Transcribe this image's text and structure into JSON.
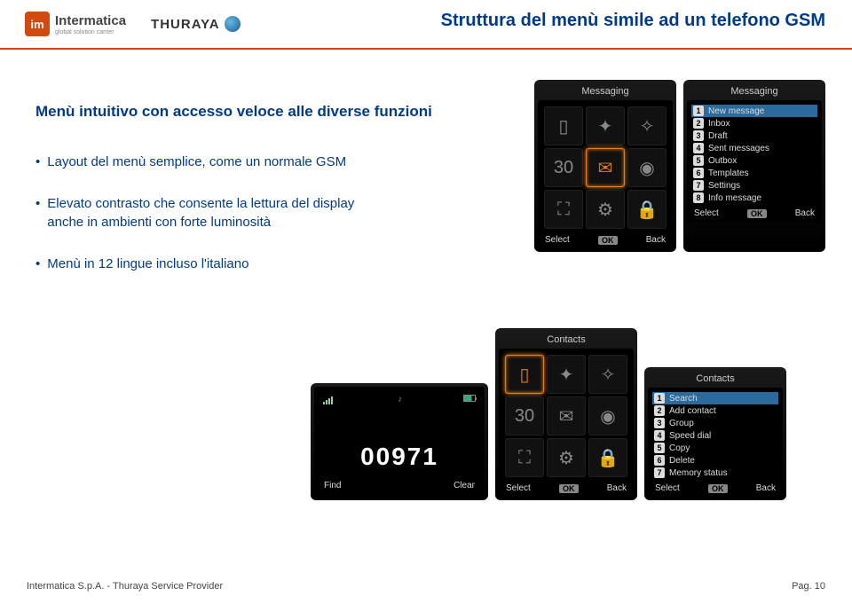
{
  "brand": {
    "im_badge": "im",
    "intermatica": "Intermatica",
    "intermatica_sub": "global solution carrier",
    "thuraya": "THURAYA"
  },
  "title": "Struttura del menù simile ad un telefono GSM",
  "subtitle": "Menù intuitivo con accesso veloce alle diverse funzioni",
  "bullets": [
    "Layout del menù semplice, come un normale GSM",
    "Elevato contrasto che consente la lettura del display anche in ambienti con forte luminosità",
    "Menù in 12 lingue incluso l'italiano"
  ],
  "softkeys": {
    "select": "Select",
    "ok": "OK",
    "back": "Back",
    "find": "Find",
    "clear": "Clear"
  },
  "screens": {
    "messaging_grid": {
      "title": "Messaging"
    },
    "messaging_list": {
      "title": "Messaging",
      "items": [
        "New message",
        "Inbox",
        "Draft",
        "Sent messages",
        "Outbox",
        "Templates",
        "Settings",
        "Info message"
      ]
    },
    "dial": {
      "number": "00971"
    },
    "contacts_grid": {
      "title": "Contacts"
    },
    "contacts_list": {
      "title": "Contacts",
      "items": [
        "Search",
        "Add contact",
        "Group",
        "Speed dial",
        "Copy",
        "Delete",
        "Memory status"
      ]
    }
  },
  "footer": {
    "left": "Intermatica S.p.A. - Thuraya Service Provider",
    "right": "Pag. 10"
  }
}
